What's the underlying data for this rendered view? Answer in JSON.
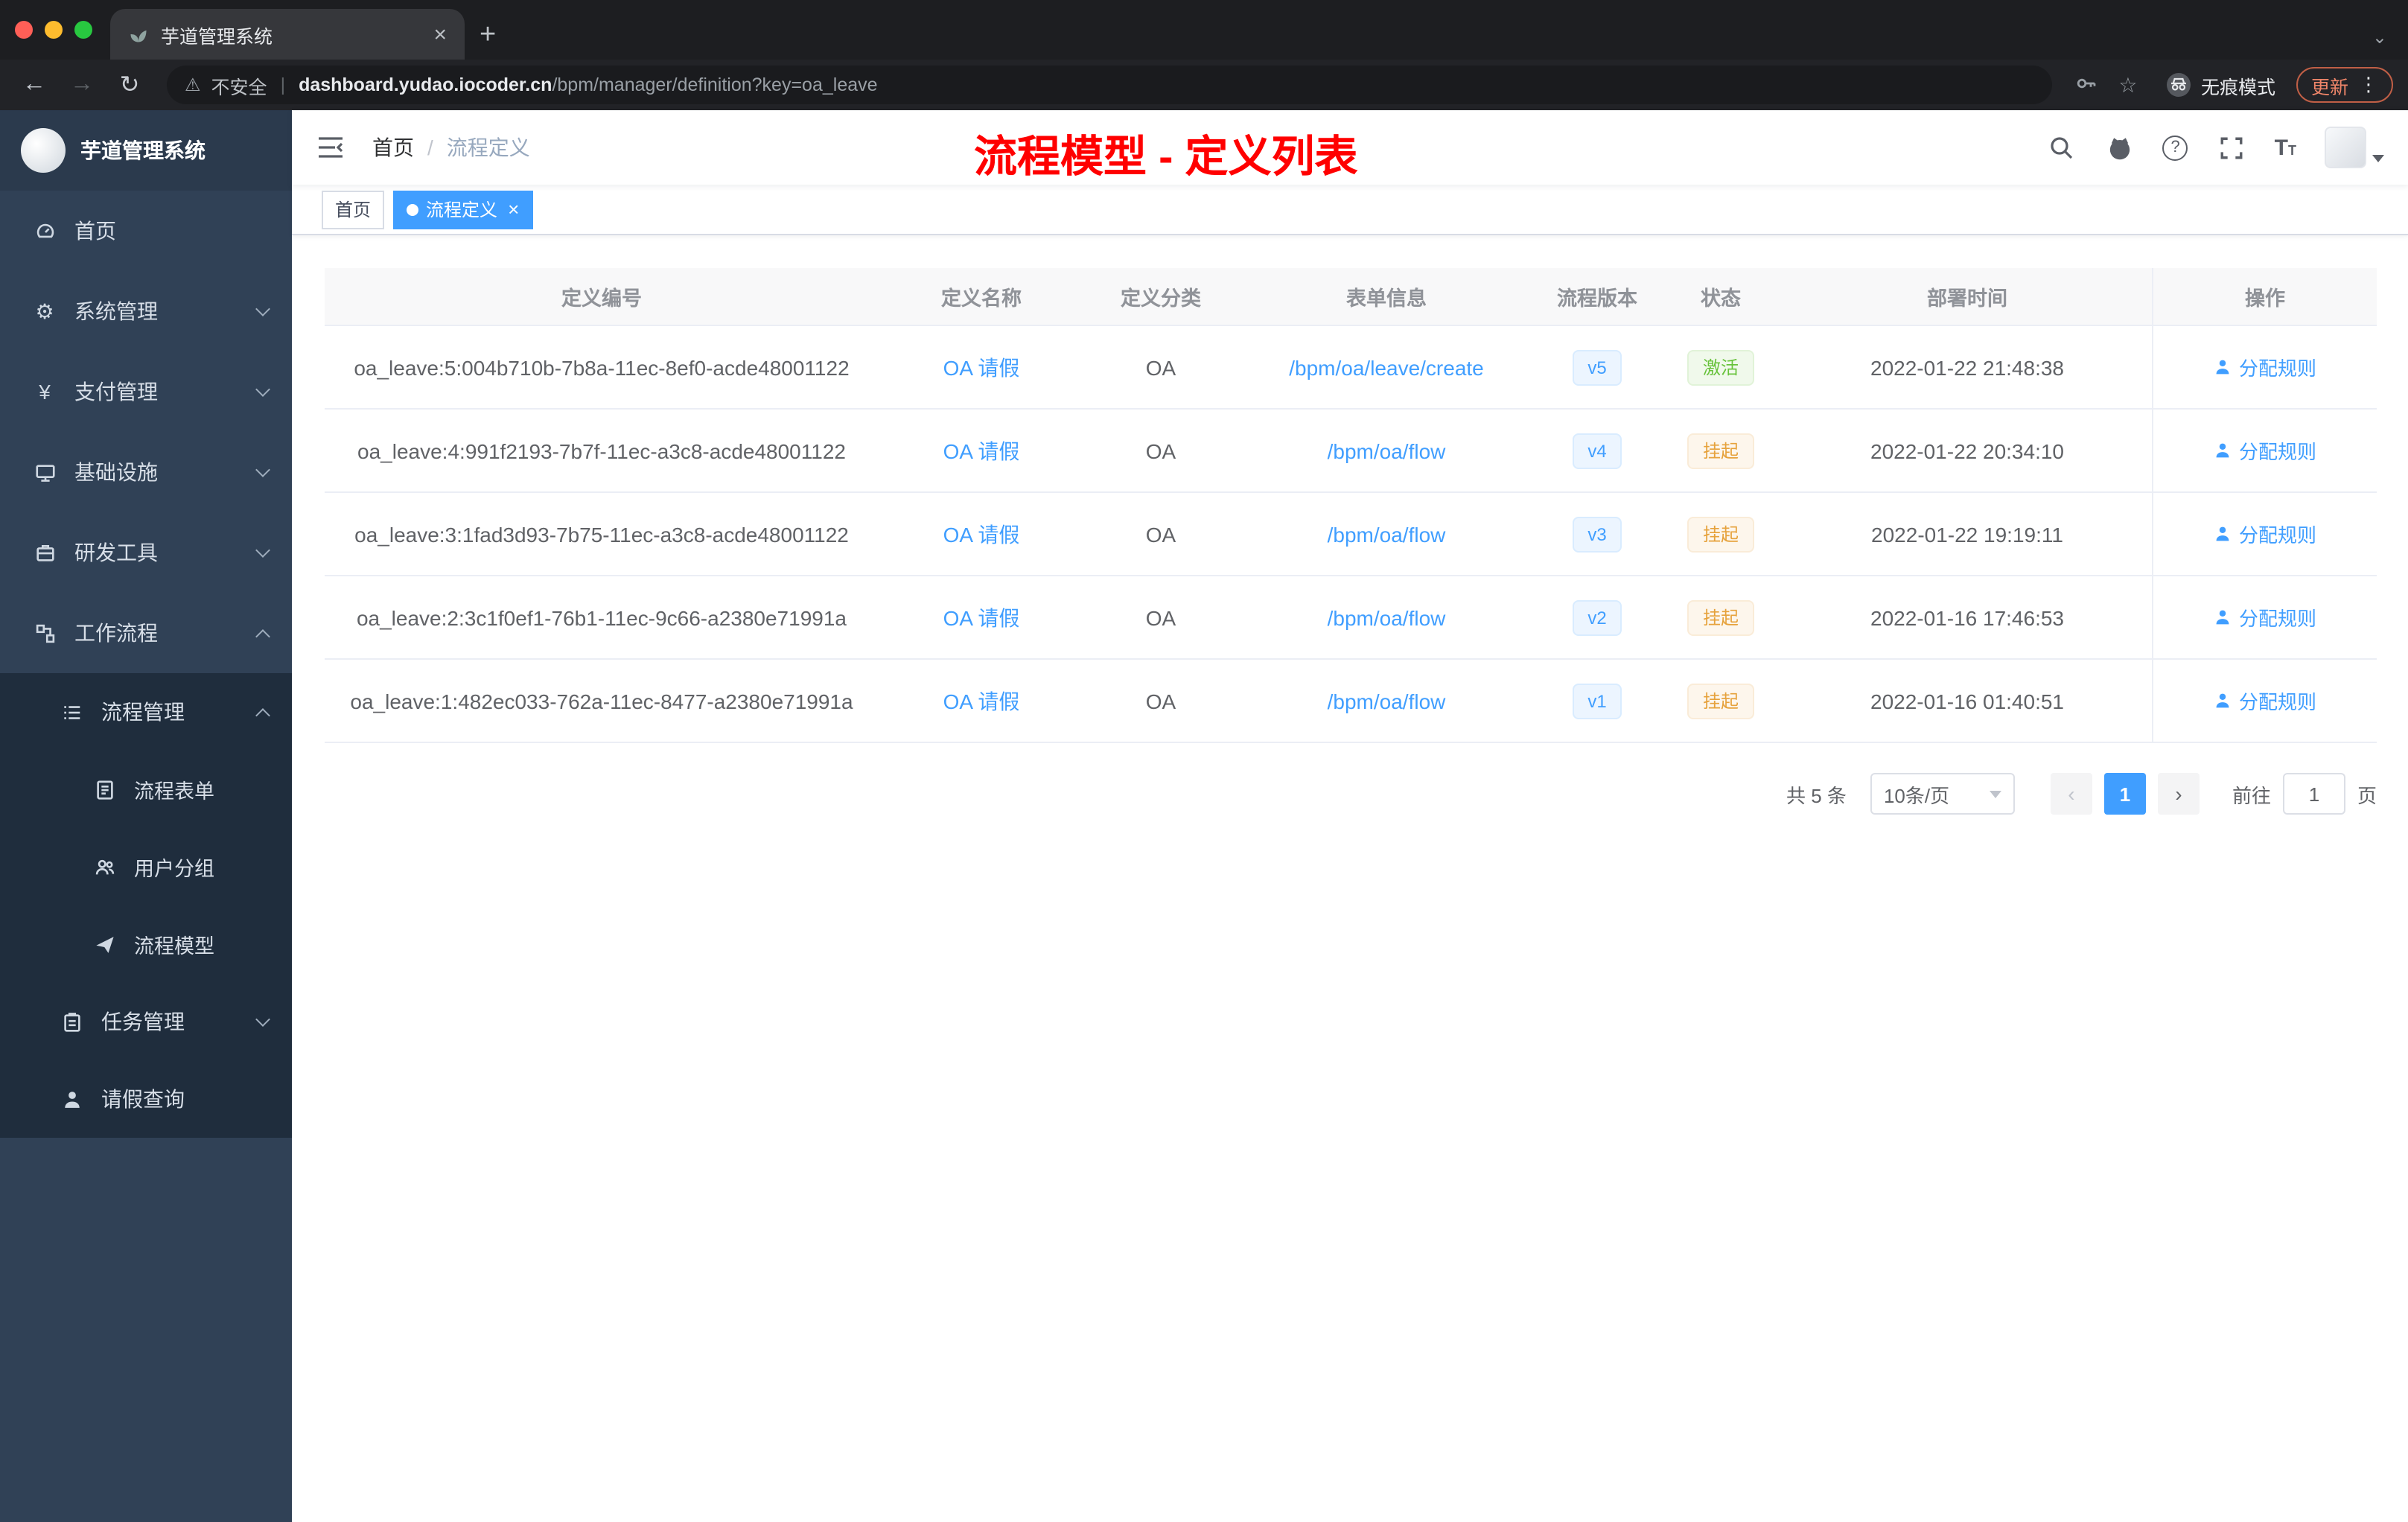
{
  "colors": {
    "accent": "#409eff",
    "success": "#67c23a",
    "warning": "#e6a23c",
    "title_red": "#ff0000",
    "sidebar_bg": "#304156",
    "submenu_bg": "#1f2d3d"
  },
  "browser": {
    "tab_title": "芋道管理系统",
    "address": {
      "security_label": "不安全",
      "host": "dashboard.yudao.iocoder.cn",
      "path": "/bpm/manager/definition?key=oa_leave"
    },
    "incognito_label": "无痕模式",
    "update_label": "更新"
  },
  "sidebar": {
    "logo_title": "芋道管理系统",
    "items": [
      {
        "label": "首页"
      },
      {
        "label": "系统管理"
      },
      {
        "label": "支付管理"
      },
      {
        "label": "基础设施"
      },
      {
        "label": "研发工具"
      },
      {
        "label": "工作流程"
      }
    ],
    "workflow_sub": {
      "process_group": {
        "label": "流程管理",
        "children": [
          {
            "label": "流程表单"
          },
          {
            "label": "用户分组"
          },
          {
            "label": "流程模型"
          }
        ]
      },
      "task": {
        "label": "任务管理"
      },
      "leave": {
        "label": "请假查询"
      }
    }
  },
  "navbar": {
    "breadcrumb_home": "首页",
    "breadcrumb_sep": "/",
    "breadcrumb_current": "流程定义",
    "overlay_title": "流程模型 - 定义列表"
  },
  "tags": {
    "home": "首页",
    "current": "流程定义"
  },
  "table": {
    "columns": [
      "定义编号",
      "定义名称",
      "定义分类",
      "表单信息",
      "流程版本",
      "状态",
      "部署时间",
      "操作"
    ],
    "rows": [
      {
        "id": "oa_leave:5:004b710b-7b8a-11ec-8ef0-acde48001122",
        "name": "OA 请假",
        "category": "OA",
        "form": "/bpm/oa/leave/create",
        "version": "v5",
        "status": "激活",
        "status_type": "success",
        "time": "2022-01-22 21:48:38",
        "action": "分配规则"
      },
      {
        "id": "oa_leave:4:991f2193-7b7f-11ec-a3c8-acde48001122",
        "name": "OA 请假",
        "category": "OA",
        "form": "/bpm/oa/flow",
        "version": "v4",
        "status": "挂起",
        "status_type": "warning",
        "time": "2022-01-22 20:34:10",
        "action": "分配规则"
      },
      {
        "id": "oa_leave:3:1fad3d93-7b75-11ec-a3c8-acde48001122",
        "name": "OA 请假",
        "category": "OA",
        "form": "/bpm/oa/flow",
        "version": "v3",
        "status": "挂起",
        "status_type": "warning",
        "time": "2022-01-22 19:19:11",
        "action": "分配规则"
      },
      {
        "id": "oa_leave:2:3c1f0ef1-76b1-11ec-9c66-a2380e71991a",
        "name": "OA 请假",
        "category": "OA",
        "form": "/bpm/oa/flow",
        "version": "v2",
        "status": "挂起",
        "status_type": "warning",
        "time": "2022-01-16 17:46:53",
        "action": "分配规则"
      },
      {
        "id": "oa_leave:1:482ec033-762a-11ec-8477-a2380e71991a",
        "name": "OA 请假",
        "category": "OA",
        "form": "/bpm/oa/flow",
        "version": "v1",
        "status": "挂起",
        "status_type": "warning",
        "time": "2022-01-16 01:40:51",
        "action": "分配规则"
      }
    ]
  },
  "pagination": {
    "total": "共 5 条",
    "page_size": "10条/页",
    "prev": "‹",
    "current_page": "1",
    "next": "›",
    "goto_label": "前往",
    "goto_value": "1",
    "unit_label": "页"
  }
}
